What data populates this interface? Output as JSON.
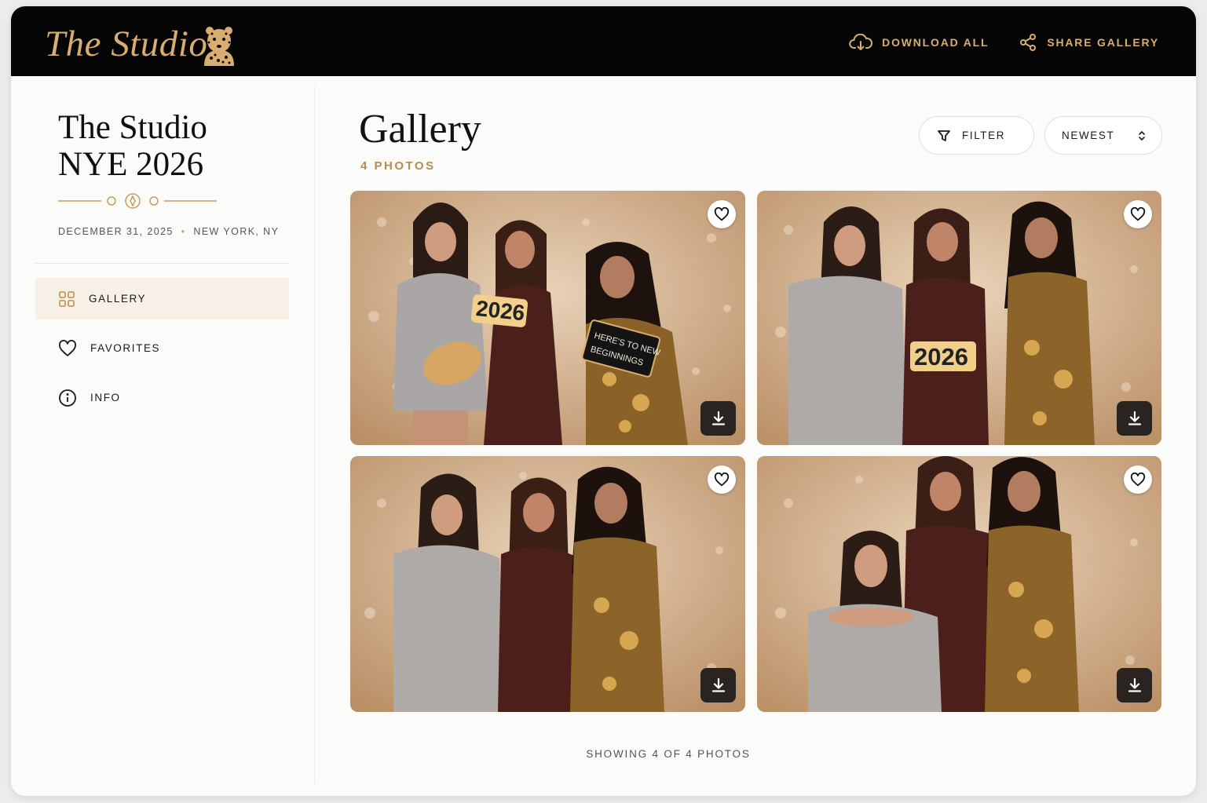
{
  "header": {
    "brand": "The Studio",
    "brand_mark_icon": "leopard-icon",
    "download_all_label": "DOWNLOAD ALL",
    "share_gallery_label": "SHARE GALLERY"
  },
  "event": {
    "title_line1": "The Studio",
    "title_line2": "NYE 2026",
    "date": "DECEMBER 31, 2025",
    "location": "NEW YORK, NY",
    "separator": "•"
  },
  "nav": {
    "items": [
      {
        "label": "GALLERY",
        "icon": "grid-icon",
        "active": true
      },
      {
        "label": "FAVORITES",
        "icon": "heart-icon",
        "active": false
      },
      {
        "label": "INFO",
        "icon": "info-icon",
        "active": false
      }
    ]
  },
  "main": {
    "title": "Gallery",
    "count": "4 PHOTOS",
    "filter_label": "FILTER",
    "sort_value": "NEWEST",
    "status": "SHOWING 4 OF 4 PHOTOS",
    "photos": [
      {
        "alt": "Three women posing with 2026 and Here's to new beginnings props",
        "props": [
          "2026",
          "HERE'S TO NEW",
          "BEGINNINGS"
        ]
      },
      {
        "alt": "Three women posing, middle woman holding 2026 sign",
        "props": [
          "2026"
        ]
      },
      {
        "alt": "Three women posing in sequin dresses"
      },
      {
        "alt": "Three women posing, one crouching in front"
      }
    ]
  },
  "colors": {
    "accent_gold": "#d9ad6f",
    "header_bg": "#050505",
    "active_nav_bg": "#f6f0e7"
  }
}
